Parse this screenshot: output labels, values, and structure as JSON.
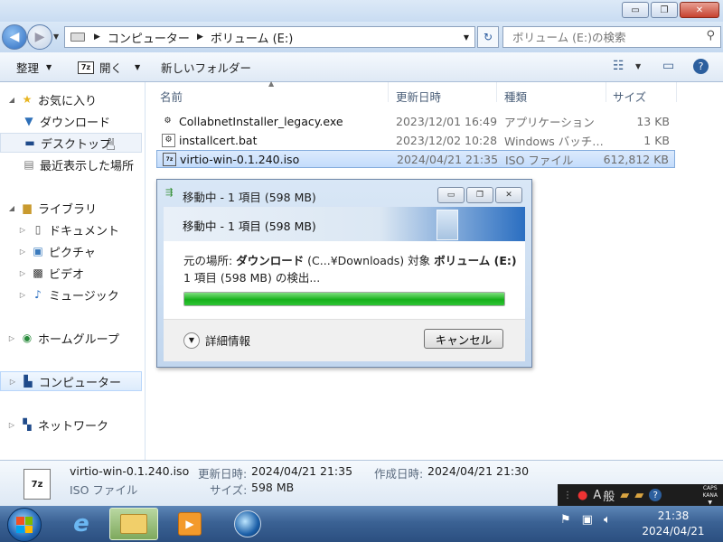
{
  "window": {
    "controls": {
      "minimize": "▭",
      "maximize": "❐",
      "close": "✕"
    }
  },
  "address": {
    "crumbs": [
      "コンピューター",
      "ボリューム (E:)"
    ],
    "search_placeholder": "ボリューム (E:)の検索"
  },
  "toolbar": {
    "organize": "整理",
    "open": "開く",
    "new_folder": "新しいフォルダー"
  },
  "nav": {
    "favorites": "お気に入り",
    "downloads": "ダウンロード",
    "desktop": "デスクトップ",
    "recent": "最近表示した場所",
    "libraries": "ライブラリ",
    "documents": "ドキュメント",
    "pictures": "ピクチャ",
    "videos": "ビデオ",
    "music": "ミュージック",
    "homegroup": "ホームグループ",
    "computer": "コンピューター",
    "network": "ネットワーク"
  },
  "columns": {
    "name": "名前",
    "date": "更新日時",
    "type": "種類",
    "size": "サイズ"
  },
  "files": [
    {
      "name": "CollabnetInstaller_legacy.exe",
      "date": "2023/12/01 16:49",
      "type": "アプリケーション",
      "size": "13 KB",
      "icon": "exe-icon"
    },
    {
      "name": "installcert.bat",
      "date": "2023/12/02 10:28",
      "type": "Windows バッチ…",
      "size": "1 KB",
      "icon": "bat-icon"
    },
    {
      "name": "virtio-win-0.1.240.iso",
      "date": "2024/04/21 21:35",
      "type": "ISO ファイル",
      "size": "612,812 KB",
      "icon": "iso-icon"
    }
  ],
  "dialog": {
    "title": "移動中 - 1 項目 (598 MB)",
    "header": "移動中 - 1 項目 (598 MB)",
    "from_label": "元の場所: ",
    "from_value": "ダウンロード",
    "from_path": " (C...¥Downloads) 対象 ",
    "to_value": "ボリューム (E:)",
    "status": "1 項目 (598 MB) の検出...",
    "progress": 1.0,
    "details": "詳細情報",
    "cancel": "キャンセル"
  },
  "details_pane": {
    "icon_text": "7z",
    "filename": "virtio-win-0.1.240.iso",
    "filetype": "ISO ファイル",
    "modified_label": "更新日時:",
    "modified_value": "2024/04/21 21:35",
    "created_label": "作成日時:",
    "created_value": "2024/04/21 21:30",
    "size_label": "サイズ:",
    "size_value": "598 MB"
  },
  "langbar": {
    "ime": "A",
    "mode": "般",
    "caps": "CAPS",
    "kana": "KANA"
  },
  "taskbar": {
    "time": "21:38",
    "date": "2024/04/21"
  },
  "colors": {
    "accent": "#2a6ec1",
    "progress": "#16b01a",
    "selection": "#c3dcfb"
  }
}
